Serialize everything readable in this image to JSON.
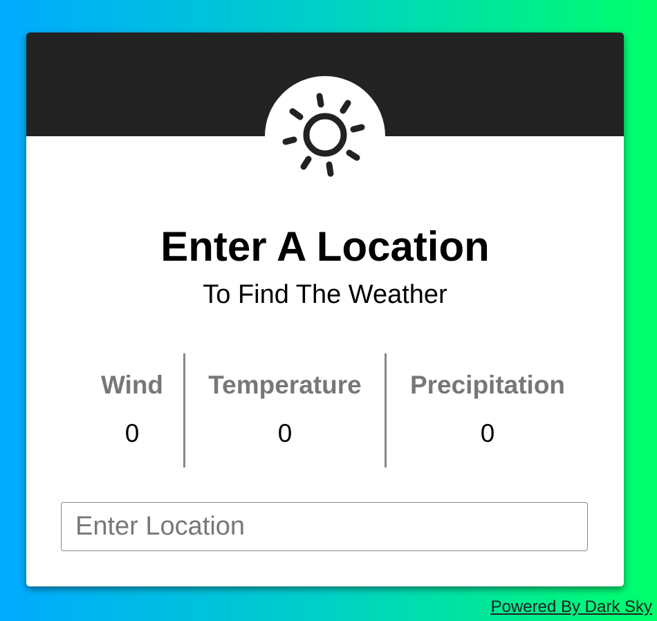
{
  "card": {
    "icon": "sun-icon",
    "title": "Enter A Location",
    "subtitle": "To Find The Weather"
  },
  "stats": [
    {
      "label": "Wind",
      "value": "0"
    },
    {
      "label": "Temperature",
      "value": "0"
    },
    {
      "label": "Precipitation",
      "value": "0"
    }
  ],
  "search": {
    "placeholder": "Enter Location",
    "value": ""
  },
  "footer": {
    "powered_by": "Powered By Dark Sky"
  },
  "colors": {
    "header": "#222222",
    "gradient_start": "#00aaff",
    "gradient_end": "#00ff6a",
    "stat_label": "#777777"
  }
}
